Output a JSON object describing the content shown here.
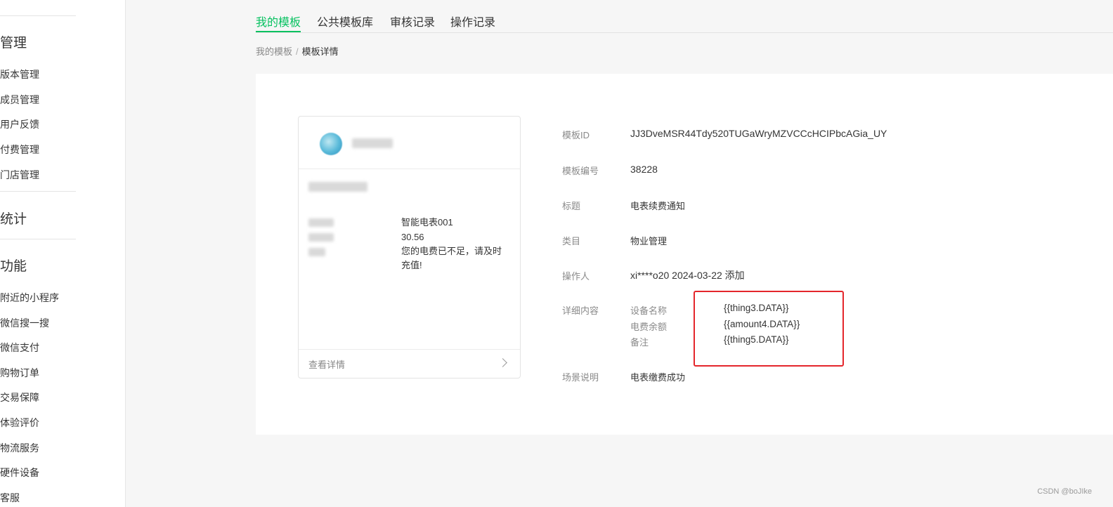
{
  "sidebar": {
    "groups": [
      {
        "label": "管理"
      },
      {
        "label": "统计"
      },
      {
        "label": "功能"
      }
    ],
    "manage_items": [
      "版本管理",
      "成员管理",
      "用户反馈",
      "付费管理",
      "门店管理"
    ],
    "feature_items": [
      "附近的小程序",
      "微信搜一搜",
      "微信支付",
      "购物订单",
      "交易保障",
      "体验评价",
      "物流服务",
      "硬件设备",
      "客服"
    ]
  },
  "tabs": [
    "我的模板",
    "公共模板库",
    "审核记录",
    "操作记录"
  ],
  "active_tab": "我的模板",
  "breadcrumb": {
    "parent": "我的模板",
    "separator": "/",
    "current": "模板详情"
  },
  "preview": {
    "rows": [
      {
        "value": "智能电表001"
      },
      {
        "value": "30.56"
      },
      {
        "value": "您的电费已不足，请及时充值!"
      }
    ],
    "footer_label": "查看详情"
  },
  "details": {
    "template_id": {
      "label": "模板ID",
      "value": "JJ3DveMSR44Tdy520TUGaWryMZVCCcHCIPbcAGia_UY"
    },
    "template_no": {
      "label": "模板编号",
      "value": "38228"
    },
    "title": {
      "label": "标题",
      "value": "电表续费通知"
    },
    "category": {
      "label": "类目",
      "value": "物业管理"
    },
    "operator": {
      "label": "操作人",
      "value": "xi****o20 2024-03-22 添加"
    },
    "content": {
      "label": "详细内容",
      "fields": [
        {
          "name": "设备名称",
          "var": "{{thing3.DATA}}"
        },
        {
          "name": "电费余额",
          "var": "{{amount4.DATA}}"
        },
        {
          "name": "备注",
          "var": "{{thing5.DATA}}"
        }
      ]
    },
    "scene": {
      "label": "场景说明",
      "value": "电表缴费成功"
    }
  },
  "colors": {
    "accent": "#07c160",
    "highlight_border": "#e4262b"
  },
  "watermark": "CSDN @boJIke"
}
